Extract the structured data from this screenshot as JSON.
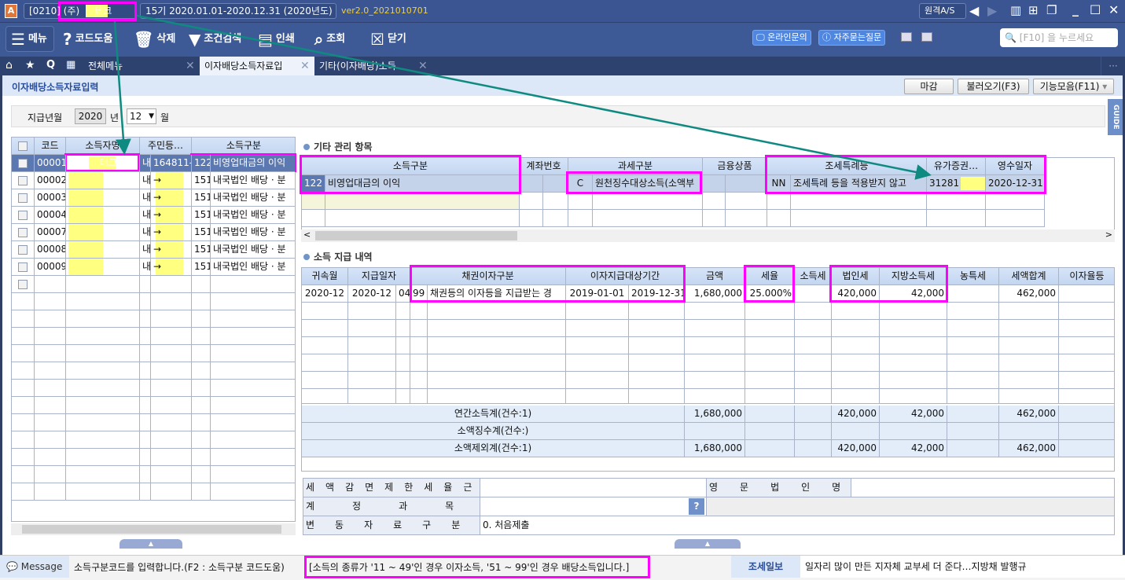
{
  "titlebar": {
    "code": "[0210]",
    "company": "(주)     테크",
    "period": "15기 2020.01.01-2020.12.31 (2020년도)",
    "version": "ver2.0_2021010701",
    "remote_as": "원격A/S"
  },
  "toolbar": {
    "menu": "메뉴",
    "code_help": "코드도움",
    "delete": "삭제",
    "filter": "조건검색",
    "print": "인쇄",
    "search": "조회",
    "close": "닫기",
    "online_inquiry": "온라인문의",
    "faq": "자주묻는질문",
    "search_placeholder": "[F10] 을 누르세요"
  },
  "tabs": [
    {
      "label": "전체메뉴"
    },
    {
      "label": "이자배당소득자료입"
    },
    {
      "label": "기타(이자배당)소득"
    }
  ],
  "page": {
    "title": "이자배당소득자료입력",
    "btn_close": "마감",
    "btn_load": "불러오기(F3)",
    "btn_functions": "기능모음(F11)",
    "guide": "GUIDE"
  },
  "filter": {
    "label": "지급년월",
    "year": "2020",
    "year_unit": "년",
    "month": "12",
    "month_unit": "월"
  },
  "left_grid": {
    "headers": [
      "코드",
      "소득자명",
      "주민등…",
      "소득구분"
    ],
    "rows": [
      {
        "code": "00001",
        "name": "(주)     테크",
        "nat": "내",
        "id": "164811-",
        "inc_code": "122",
        "inc_name": "비영업대금의 이익"
      },
      {
        "code": "00002",
        "name": "",
        "nat": "내",
        "id": "→",
        "inc_code": "151",
        "inc_name": "내국법인 배당 · 분"
      },
      {
        "code": "00003",
        "name": "",
        "nat": "내",
        "id": "→",
        "inc_code": "151",
        "inc_name": "내국법인 배당 · 분"
      },
      {
        "code": "00004",
        "name": "",
        "nat": "내",
        "id": "→",
        "inc_code": "151",
        "inc_name": "내국법인 배당 · 분"
      },
      {
        "code": "00007",
        "name": "",
        "nat": "내",
        "id": "→",
        "inc_code": "151",
        "inc_name": "내국법인 배당 · 분"
      },
      {
        "code": "00008",
        "name": "",
        "nat": "내",
        "id": "→",
        "inc_code": "151",
        "inc_name": "내국법인 배당 · 분"
      },
      {
        "code": "00009",
        "name": "",
        "nat": "내",
        "id": "→",
        "inc_code": "151",
        "inc_name": "내국법인 배당 · 분"
      }
    ]
  },
  "etc_section": {
    "title": "기타 관리 항목",
    "headers": [
      "소득구분",
      "계좌번호",
      "과세구분",
      "금융상품",
      "조세특례등",
      "유가증권…",
      "영수일자"
    ],
    "row": {
      "inc_code": "122",
      "inc_name": "비영업대금의 이익",
      "tax_code": "C",
      "tax_name": "원천징수대상소득(소액부",
      "special_code": "NN",
      "special_name": "조세특례 등을 적용받지 않고",
      "securities": "31281",
      "receipt_date": "2020-12-31"
    }
  },
  "pay_section": {
    "title": "소득 지급 내역",
    "headers": [
      "귀속월",
      "지급일자",
      "채권이자구분",
      "이자지급대상기간",
      "금액",
      "세율",
      "소득세",
      "법인세",
      "지방소득세",
      "농특세",
      "세액합계",
      "이자율등"
    ],
    "row": {
      "month": "2020-12",
      "pay_ym": "2020-12",
      "pay_day": "04",
      "bond_code": "99",
      "bond_name": "채권등의 이자등을 지급받는 경",
      "from": "2019-01-01",
      "to": "2019-12-31",
      "amount": "1,680,000",
      "rate": "25.000%",
      "income_tax": "",
      "corp_tax": "420,000",
      "local_tax": "42,000",
      "rural_tax": "",
      "total_tax": "462,000",
      "interest": ""
    },
    "summary": [
      {
        "label": "연간소득계(건수:1)",
        "amount": "1,680,000",
        "corp_tax": "420,000",
        "local_tax": "42,000",
        "total_tax": "462,000"
      },
      {
        "label": "소액징수계(건수:)",
        "amount": "",
        "corp_tax": "",
        "local_tax": "",
        "total_tax": ""
      },
      {
        "label": "소액제외계(건수:1)",
        "amount": "1,680,000",
        "corp_tax": "420,000",
        "local_tax": "42,000",
        "total_tax": "462,000"
      }
    ]
  },
  "form": {
    "reduction_label": "세액감면제한세율근거",
    "reduction_value": "",
    "english_name_label": "영문법인명",
    "english_name_value": "",
    "account_label": "계정과목",
    "account_value": "",
    "help": "?",
    "change_label": "변동자료구분",
    "change_value": "0. 처음제출"
  },
  "status": {
    "message_label": "Message",
    "message": "소득구분코드를 입력합니다.(F2 : 소득구분 코드도움)",
    "hint": "[소득의 종류가 '11 ~ 49'인 경우 이자소득, '51 ~ 99'인 경우 배당소득입니다.]",
    "news_source": "조세일보",
    "news": "일자리 많이 만든 지자체 교부세 더 준다…지방채 발행규"
  },
  "colors": {
    "accent": "#3d5a97",
    "highlight": "#ff00ff",
    "arrow": "#0e8a80"
  }
}
